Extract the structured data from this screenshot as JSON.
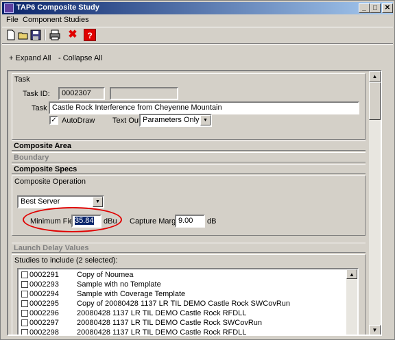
{
  "window": {
    "title": "TAP6 Composite Study",
    "minimize_glyph": "_",
    "maximize_glyph": "□",
    "close_glyph": "✕"
  },
  "menu": [
    "File",
    "Component Studies"
  ],
  "toolbar": {
    "buttons": [
      "new-icon",
      "open-icon",
      "save-icon",
      "print-icon",
      "delete-icon",
      "help-icon"
    ],
    "delete_glyph": "✖",
    "help_glyph": "?"
  },
  "links": {
    "expand_all": "+ Expand All",
    "collapse_all": "- Collapse All"
  },
  "task": {
    "section": "Task",
    "task_id_label": "Task ID:",
    "task_id": "0002307",
    "task_id_extra": "",
    "task_label": "Task",
    "task_value": "Castle Rock Interference from Cheyenne Mountain",
    "autodraw_label": "AutoDraw",
    "autodraw_checked": true,
    "autodraw_mark": "✓",
    "text_out_label": "Text Out:",
    "text_out_value": "Parameters Only"
  },
  "sections": {
    "composite_area": "Composite Area",
    "boundary": "Boundary",
    "composite_specs": "Composite Specs",
    "launch_delay": "Launch Delay Values"
  },
  "composite": {
    "operation_label": "Composite Operation",
    "operation_value": "Best Server",
    "min_field_label": "Minimum Field",
    "min_field_value": "35.84",
    "min_field_unit": "dBu",
    "capture_margin_label": "Capture Margin",
    "capture_margin_value": "9.00",
    "capture_margin_unit": "dB"
  },
  "studies": {
    "label": "Studies to include (2 selected):",
    "rows": [
      {
        "id": "0002291",
        "name": "Copy of Noumea"
      },
      {
        "id": "0002293",
        "name": "Sample with no Template"
      },
      {
        "id": "0002294",
        "name": "Sample with Coverage Template"
      },
      {
        "id": "0002295",
        "name": "Copy of 20080428 1137 LR TIL DEMO Castle Rock SWCovRun"
      },
      {
        "id": "0002296",
        "name": "20080428 1137 LR TIL DEMO Castle Rock RFDLL"
      },
      {
        "id": "0002297",
        "name": "20080428 1137 LR TIL DEMO Castle Rock SWCovRun"
      },
      {
        "id": "0002298",
        "name": "20080428 1137 LR TIL DEMO Castle Rock RFDLL"
      }
    ]
  },
  "scroll_glyphs": {
    "up": "▲",
    "down": "▼"
  },
  "colors": {
    "title_start": "#0a246a",
    "title_end": "#a6caf0",
    "highlight": "#e00000",
    "selection": "#0a246a"
  }
}
